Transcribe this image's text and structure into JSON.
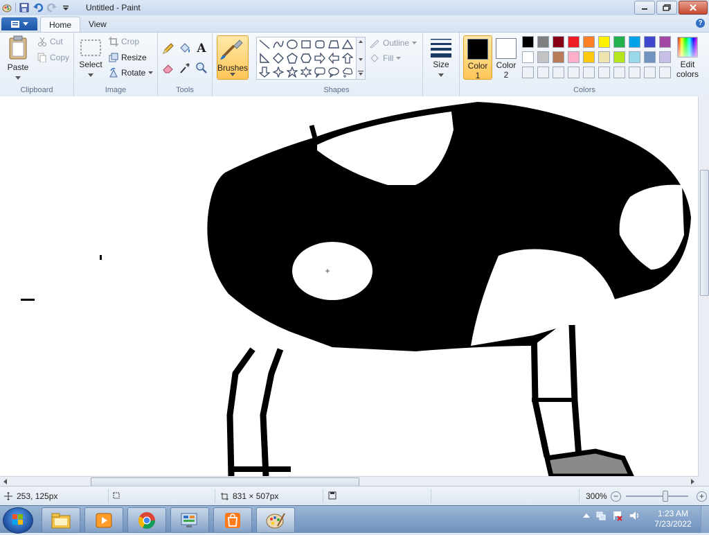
{
  "window": {
    "title": "Untitled - Paint"
  },
  "tabs": [
    {
      "label": "Home"
    },
    {
      "label": "View"
    }
  ],
  "clipboard": {
    "paste": "Paste",
    "cut": "Cut",
    "copy": "Copy",
    "group": "Clipboard"
  },
  "image": {
    "select": "Select",
    "crop": "Crop",
    "resize": "Resize",
    "rotate": "Rotate",
    "group": "Image"
  },
  "tools": {
    "group": "Tools",
    "text_glyph": "A"
  },
  "brushes": {
    "label": "Brushes"
  },
  "shapes": {
    "group": "Shapes",
    "outline": "Outline",
    "fill": "Fill"
  },
  "size": {
    "label": "Size"
  },
  "colors": {
    "color1_label": "Color",
    "color1_num": "1",
    "color2_label": "Color",
    "color2_num": "2",
    "color1_value": "#000000",
    "color2_value": "#ffffff",
    "edit_line1": "Edit",
    "edit_line2": "colors",
    "group": "Colors",
    "palette_row1": [
      "#000000",
      "#7f7f7f",
      "#880015",
      "#ed1c24",
      "#ff7f27",
      "#fff200",
      "#22b14c",
      "#00a2e8",
      "#3f48cc",
      "#a349a4"
    ],
    "palette_row2": [
      "#ffffff",
      "#c3c3c3",
      "#b97a57",
      "#ffaec9",
      "#ffc90e",
      "#efe4b0",
      "#b5e61d",
      "#99d9ea",
      "#7092be",
      "#c8bfe7"
    ]
  },
  "status": {
    "cursor_pos": "253, 125px",
    "canvas_size": "831 × 507px",
    "zoom": "300%"
  },
  "clock": {
    "time": "1:23 AM",
    "date": "7/23/2022"
  }
}
